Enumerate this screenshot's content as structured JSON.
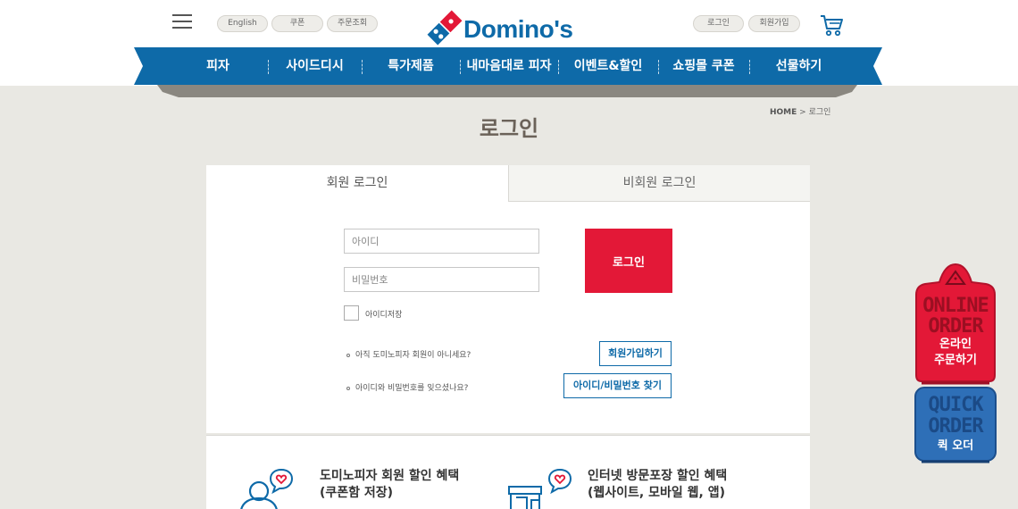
{
  "header": {
    "lang_pills": [
      {
        "label": "English"
      },
      {
        "label": "쿠폰"
      },
      {
        "label": "주문조회"
      }
    ],
    "logo_text": "Domino's",
    "auth_pills": [
      {
        "label": "로그인"
      },
      {
        "label": "회원가입"
      }
    ]
  },
  "nav": {
    "items": [
      {
        "label": "피자"
      },
      {
        "label": "사이드디시"
      },
      {
        "label": "특가제품"
      },
      {
        "label": "내마음대로 피자"
      },
      {
        "label": "이벤트&할인"
      },
      {
        "label": "쇼핑몰 쿠폰"
      },
      {
        "label": "선물하기"
      }
    ]
  },
  "breadcrumb": {
    "home": "HOME",
    "sep": ">",
    "current": "로그인"
  },
  "page_title": "로그인",
  "tabs": {
    "member": "회원 로그인",
    "guest": "비회원 로그인"
  },
  "form": {
    "id_placeholder": "아이디",
    "pw_placeholder": "비밀번호",
    "login_button": "로그인",
    "remember_label": "아이디저장",
    "signup_prompt": "아직 도미노피자 회원이 아니세요?",
    "signup_button": "회원가입하기",
    "find_prompt": "아이디와 비밀번호를 잊으셨나요?",
    "find_button": "아이디/비밀번호 찾기"
  },
  "benefits": [
    {
      "title": "도미노피자 회원 할인 혜택",
      "subtitle": "(쿠폰함 저장)"
    },
    {
      "title": "인터넷 방문포장 할인 혜택",
      "subtitle": "(웹사이트, 모바일 웹, 앱)"
    }
  ],
  "floating": {
    "online": {
      "en_line1": "ONLINE",
      "en_line2": "ORDER",
      "ko_line1": "온라인",
      "ko_line2": "주문하기"
    },
    "quick": {
      "en_line1": "QUICK",
      "en_line2": "ORDER",
      "ko": "퀵 오더"
    }
  },
  "colors": {
    "brand_blue": "#0e6aa8",
    "brand_red": "#e31837",
    "page_bg": "#e9e8e3",
    "quick_blue": "#2e6fb7"
  }
}
